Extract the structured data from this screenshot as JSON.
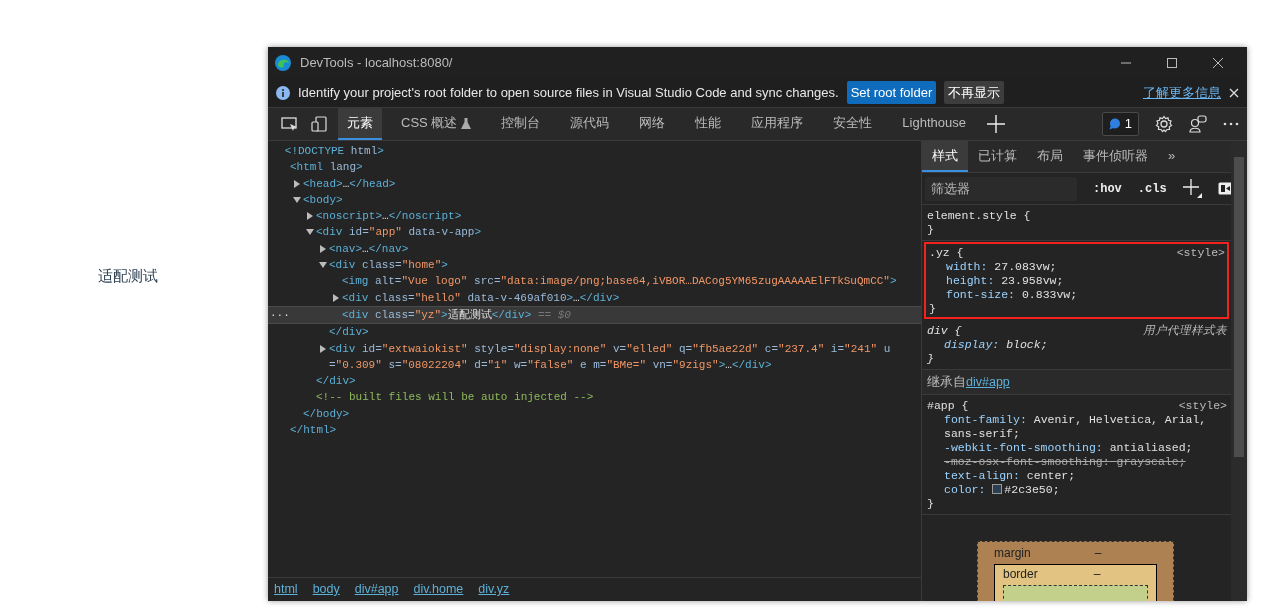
{
  "page": {
    "text": "适配测试"
  },
  "window": {
    "title": "DevTools - localhost:8080/"
  },
  "infobar": {
    "message": "Identify your project's root folder to open source files in Visual Studio Code and sync changes.",
    "buttons": [
      {
        "label": "Set root folder",
        "kind": "primary"
      },
      {
        "label": "不再显示",
        "kind": "secondary"
      }
    ],
    "link": "了解更多信息"
  },
  "tabs": [
    {
      "label": "元素",
      "selected": true,
      "experimental": false
    },
    {
      "label": "CSS 概述",
      "selected": false,
      "experimental": true
    },
    {
      "label": "控制台",
      "selected": false,
      "experimental": false
    },
    {
      "label": "源代码",
      "selected": false,
      "experimental": false
    },
    {
      "label": "网络",
      "selected": false,
      "experimental": false
    },
    {
      "label": "性能",
      "selected": false,
      "experimental": false
    },
    {
      "label": "应用程序",
      "selected": false,
      "experimental": false
    },
    {
      "label": "安全性",
      "selected": false,
      "experimental": false
    },
    {
      "label": "Lighthouse",
      "selected": false,
      "experimental": false
    }
  ],
  "issues": {
    "count": "1"
  },
  "dom": {
    "nodes": [
      {
        "text": "<!DOCTYPE html>",
        "selected": false
      },
      {
        "text": "<html lang>",
        "selected": false,
        "closing": "</html>",
        "children": [
          {
            "text": "<head>…</head>",
            "selected": false,
            "expanded": false
          },
          {
            "text": "<body>",
            "selected": false,
            "expanded": true,
            "closing": "</body>",
            "children": [
              {
                "text": "<noscript>…</noscript>",
                "selected": false,
                "expanded": false
              },
              {
                "text": "<div id=\"app\" data-v-app>",
                "selected": false,
                "expanded": true,
                "closing": "</div>",
                "children": [
                  {
                    "text": "<nav>…</nav>",
                    "selected": false,
                    "expanded": false
                  },
                  {
                    "text": "<div class=\"home\">",
                    "selected": false,
                    "expanded": true,
                    "closing": "</div>",
                    "children": [
                      {
                        "text": "<img alt=\"Vue logo\" src=\"data:image/png;base64,iVBOR…DACog5YM65zugAAAAAElFTkSuQmCC\">",
                        "selected": false
                      },
                      {
                        "text": "<div class=\"hello\" data-v-469af010>…</div>",
                        "selected": false,
                        "expanded": false
                      },
                      {
                        "text": "<div class=\"yz\">适配测试</div>",
                        "selected": true,
                        "marker": "== $0",
                        "gutter": "···"
                      }
                    ]
                  },
                  {
                    "text": "<div id=\"extwaiokist\" style=\"display:none\" v=\"elled\" q=\"fb5ae22d\" c=\"237.4\" i=\"241\" u=\"0.309\" s=\"08022204\" d=\"1\" w=\"false\" e m=\"BMe=\" vn=\"9zigs\">…</div>",
                    "selected": false,
                    "expanded": false
                  }
                ]
              },
              {
                "text": "<!-- built files will be auto injected -->",
                "selected": false
              }
            ]
          }
        ]
      }
    ],
    "breadcrumbs": [
      "html",
      "body",
      "div#app",
      "div.home",
      "div.yz"
    ]
  },
  "styles": {
    "tabs": [
      {
        "label": "样式",
        "selected": true
      },
      {
        "label": "已计算",
        "selected": false
      },
      {
        "label": "布局",
        "selected": false
      },
      {
        "label": "事件侦听器",
        "selected": false
      }
    ],
    "overflow": "»",
    "filter": {
      "placeholder": "筛选器"
    },
    "toggles": [
      ":hov",
      ".cls"
    ],
    "sections": [
      {
        "kind": "rule",
        "selector": "element.style {",
        "closing": "}",
        "annotated": false,
        "italic": false
      },
      {
        "kind": "rule",
        "selector": ".yz {",
        "source": "<style>",
        "closing": "}",
        "annotated": true,
        "italic": false,
        "properties": [
          {
            "name": "width:",
            "value": "27.083vw;",
            "struck": false
          },
          {
            "name": "height:",
            "value": "23.958vw;",
            "struck": false
          },
          {
            "name": "font-size:",
            "value": "0.833vw;",
            "struck": false
          }
        ]
      },
      {
        "kind": "rule",
        "selector": "div {",
        "source": "用户代理样式表",
        "closing": "}",
        "annotated": false,
        "italic": true,
        "properties": [
          {
            "name": "display:",
            "value": "block;",
            "struck": false
          }
        ]
      },
      {
        "kind": "inherited",
        "label": "继承自",
        "link": "div#app"
      },
      {
        "kind": "rule",
        "selector": "#app {",
        "source": "<style>",
        "closing": "}",
        "annotated": false,
        "italic": false,
        "properties": [
          {
            "name": "font-family:",
            "value": "Avenir, Helvetica, Arial, sans-serif;",
            "struck": false
          },
          {
            "name": "-webkit-font-smoothing:",
            "value": "antialiased;",
            "struck": false
          },
          {
            "name": "-moz-osx-font-smoothing:",
            "value": "grayscale;",
            "struck": true
          },
          {
            "name": "text-align:",
            "value": "center;",
            "struck": false
          },
          {
            "name": "color:",
            "value": "#2c3e50;",
            "struck": false,
            "color": "#2c3e50"
          }
        ]
      }
    ],
    "box_model": {
      "margin": {
        "label": "margin",
        "value": "–"
      },
      "border": {
        "label": "border",
        "value": "–"
      }
    }
  }
}
